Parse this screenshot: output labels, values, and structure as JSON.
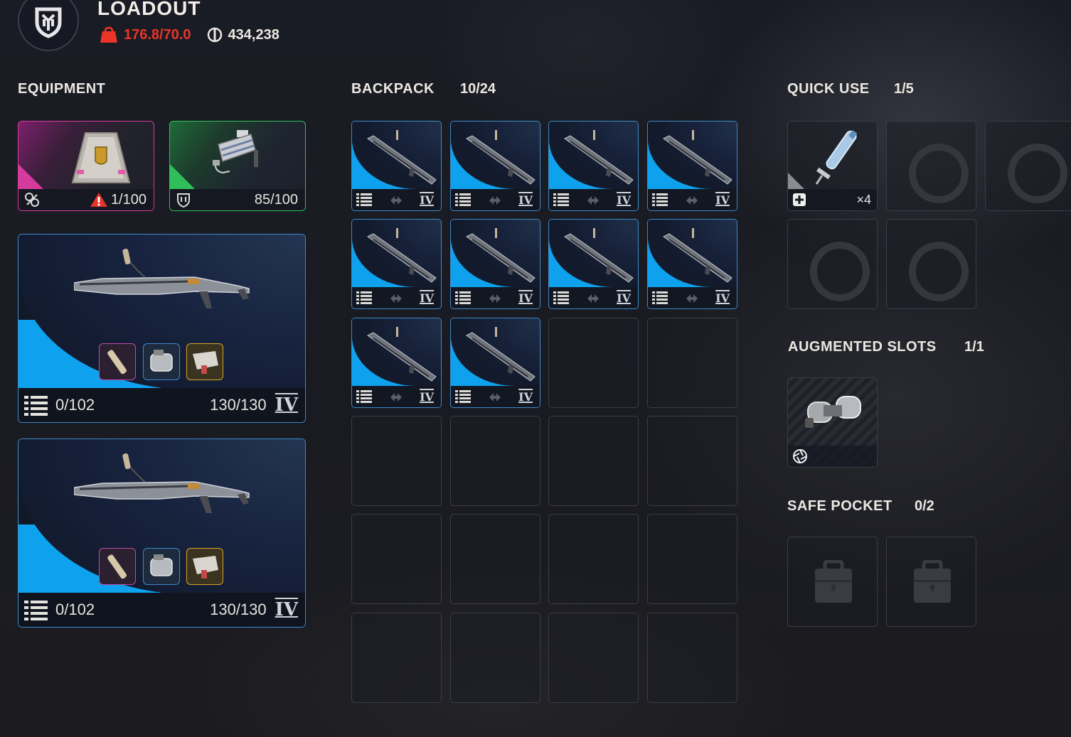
{
  "header": {
    "title": "LOADOUT",
    "weight": "176.8/70.0",
    "currency": "434,238"
  },
  "colors": {
    "overweight": "#ea3528",
    "accent_blue": "#0ea2ee",
    "border_blue": "#3d88c8",
    "augment_pink": "#d53a9d",
    "shield_green": "#2fbf5a"
  },
  "equipment": {
    "title": "EQUIPMENT",
    "augment": {
      "icon": "augment-pack-icon",
      "warning_icon": "warning-triangle-icon",
      "durability": "1/100"
    },
    "shield": {
      "icon": "shield-icon",
      "durability": "85/100"
    },
    "weapons": [
      {
        "ammo": "0/102",
        "durability": "130/130",
        "tier": "IV"
      },
      {
        "ammo": "0/102",
        "durability": "130/130",
        "tier": "IV"
      }
    ]
  },
  "backpack": {
    "title": "BACKPACK",
    "count": "10/24",
    "item_tier": "IV"
  },
  "quick_use": {
    "title": "QUICK USE",
    "count": "1/5",
    "item_qty": "×4"
  },
  "augmented_slots": {
    "title": "AUGMENTED SLOTS",
    "count": "1/1"
  },
  "safe_pocket": {
    "title": "SAFE POCKET",
    "count": "0/2"
  }
}
